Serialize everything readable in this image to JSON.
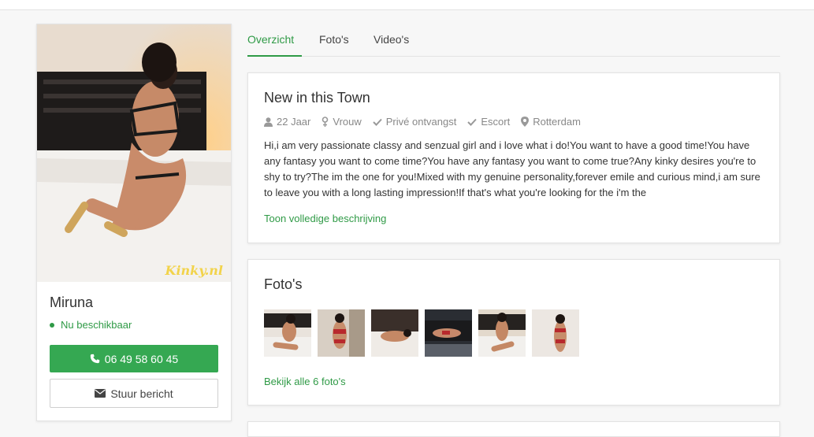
{
  "profile": {
    "name": "Miruna",
    "status": "Nu beschikbaar",
    "watermark": "Kinky.nl",
    "phone_label": "06 49 58 60 45",
    "message_label": "Stuur bericht"
  },
  "tabs": [
    {
      "label": "Overzicht"
    },
    {
      "label": "Foto's"
    },
    {
      "label": "Video's"
    }
  ],
  "about": {
    "title": "New in this Town",
    "meta": {
      "age": "22 Jaar",
      "gender": "Vrouw",
      "private": "Privé ontvangst",
      "escort": "Escort",
      "city": "Rotterdam"
    },
    "description": "Hi,i am very passionate classy and senzual girl and i love what i do!You want to have a good time!You have any fantasy you want to come time?You have any fantasy you want to come true?Any kinky desires you're to shy to try?The im the one for you!Mixed with my genuine personality,forever emile and curious mind,i am sure to leave you with a long lasting impression!If that's what you're looking for the i'm the",
    "more_label": "Toon volledige beschrijving"
  },
  "photos": {
    "title": "Foto's",
    "all_label": "Bekijk alle 6 foto's"
  },
  "colors": {
    "accent": "#2f9a46",
    "button": "#35a852"
  }
}
